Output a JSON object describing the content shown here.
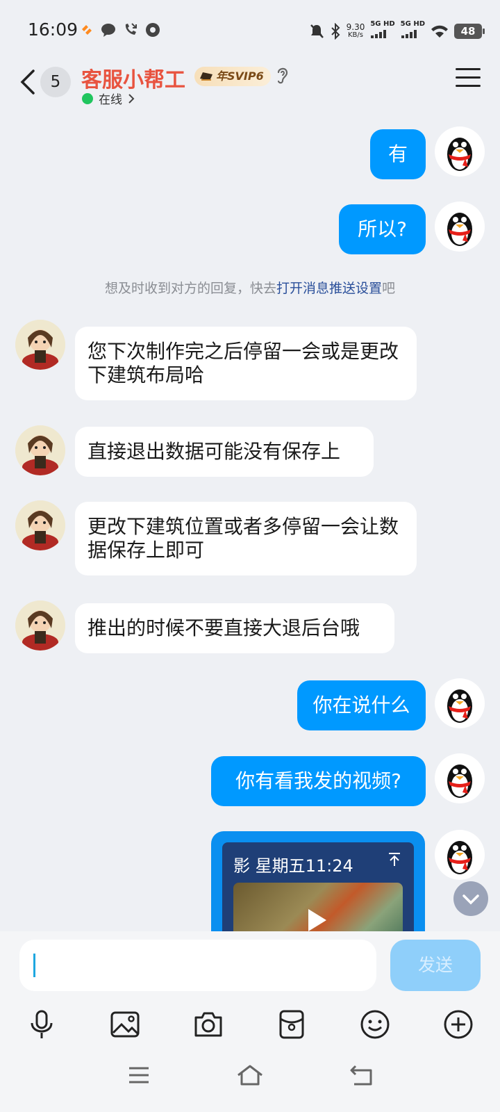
{
  "status_bar": {
    "time": "16:09",
    "speed_value": "9.30",
    "speed_unit": "KB/s",
    "net1": "5G HD",
    "net2": "5G HD",
    "battery": "48"
  },
  "header": {
    "unread_count": "5",
    "contact_name": "客服小帮工",
    "vip_label": "年SVIP6",
    "online_status": "在线",
    "name_color": "#e8533f",
    "online_color": "#20c55e"
  },
  "messages": [
    {
      "sender": "self",
      "text": "有"
    },
    {
      "sender": "self",
      "text": "所以?"
    },
    {
      "sender": "agent",
      "text": "您下次制作完之后停留一会或是更改下建筑布局哈"
    },
    {
      "sender": "agent",
      "text": "直接退出数据可能没有保存上"
    },
    {
      "sender": "agent",
      "text": "更改下建筑位置或者多停留一会让数据保存上即可"
    },
    {
      "sender": "agent",
      "text": "推出的时候不要直接大退后台哦"
    },
    {
      "sender": "self",
      "text": "你在说什么"
    },
    {
      "sender": "self",
      "text": "你有看我发的视频?"
    }
  ],
  "system_tip": {
    "prefix": "想及时收到对方的回复，快去",
    "link": "打开消息推送设置",
    "suffix": "吧"
  },
  "video_message": {
    "title": "影  星期五11:24",
    "pin_icon": "pin-icon"
  },
  "input": {
    "value": "",
    "send_label": "发送"
  },
  "toolbar_icons": [
    "microphone-icon",
    "image-icon",
    "camera-icon",
    "red-packet-icon",
    "emoji-icon",
    "plus-icon"
  ],
  "nav_icons": [
    "menu-icon",
    "home-icon",
    "back-icon"
  ],
  "colors": {
    "bubble_out": "#0099ff",
    "bubble_in": "#ffffff",
    "background": "#eef0f4"
  }
}
